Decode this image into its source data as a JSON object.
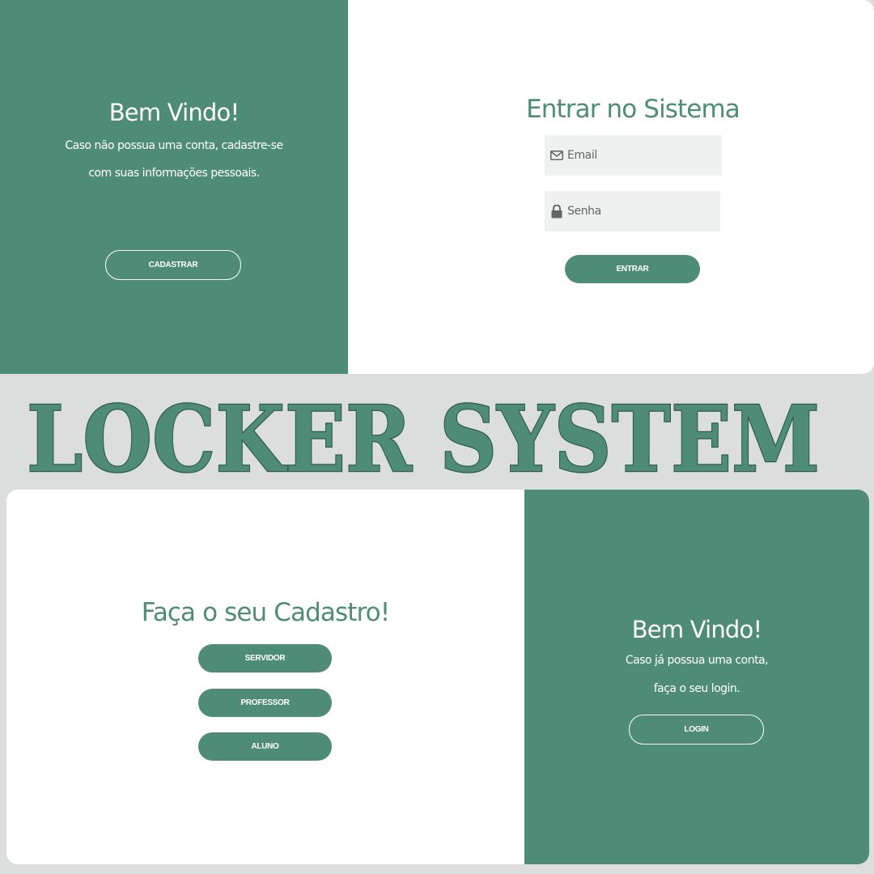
{
  "login_screen": {
    "welcome": {
      "title": "Bem Vindo!",
      "line1": "Caso não possua uma conta, cadastre-se",
      "line2": "com suas informações pessoais.",
      "button": "CADASTRAR"
    },
    "form": {
      "title": "Entrar no Sistema",
      "email_placeholder": "Email",
      "email_icon": "envelope-icon",
      "password_placeholder": "Senha",
      "password_icon": "lock-icon",
      "submit": "ENTRAR"
    }
  },
  "banner": {
    "text": "LOCKER SYSTEM"
  },
  "register_screen": {
    "form": {
      "title": "Faça o seu Cadastro!",
      "options": [
        "SERVIDOR",
        "PROFESSOR",
        "ALUNO"
      ]
    },
    "welcome": {
      "title": "Bem Vindo!",
      "line1": "Caso já possua uma conta,",
      "line2": "faça o seu login.",
      "button": "LOGIN"
    }
  },
  "colors": {
    "accent": "#4f8c78",
    "background": "#dcdedd",
    "input_bg": "#eef1f0",
    "banner_text": "#4f8c78",
    "banner_outline": "#2f5b4c"
  }
}
